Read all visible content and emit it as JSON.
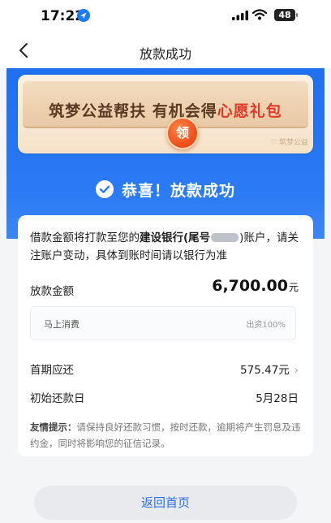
{
  "status_bar": {
    "time": "17:22",
    "battery": "48"
  },
  "nav": {
    "title": "放款成功"
  },
  "banner": {
    "text_main": "筑梦公益帮扶 有机会得",
    "text_highlight": "心愿礼包",
    "claim_label": "领",
    "badge": "♡ 筑梦公益"
  },
  "success": {
    "text": "恭喜！放款成功"
  },
  "notice": {
    "prefix": "借款金额将打款至您的",
    "bank": "建设银行(尾号",
    "suffix": ")账户，请关注账户变动，具体到账时间请以银行为准"
  },
  "loan": {
    "amount_label": "放款金额",
    "amount_value": "6,700.00",
    "amount_unit": "元",
    "lender_name": "马上消费",
    "lender_ratio": "出资100%"
  },
  "rows": [
    {
      "label": "首期应还",
      "value": "575.47元"
    },
    {
      "label": "初始还款日",
      "value": "5月28日"
    }
  ],
  "tip": {
    "label": "友情提示：",
    "text": "请保持良好还款习惯，按时还款，逾期将产生罚息及违约金，同时将影响您的征信记录。"
  },
  "footer": {
    "home_button": "返回首页"
  },
  "colors": {
    "brand_blue": "#2a7af5",
    "highlight_red": "#e13a2a"
  }
}
